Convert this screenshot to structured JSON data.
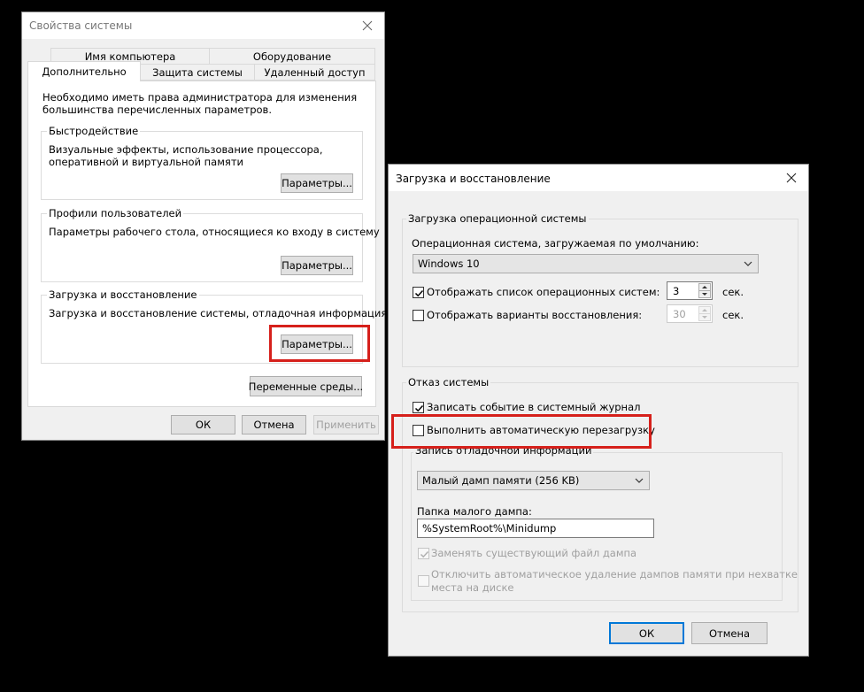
{
  "system_props": {
    "title": "Свойства системы",
    "tabs_row1": [
      "Имя компьютера",
      "Оборудование"
    ],
    "tabs_row2": [
      "Дополнительно",
      "Защита системы",
      "Удаленный доступ"
    ],
    "admin_note": "Необходимо иметь права администратора для изменения большинства перечисленных параметров.",
    "performance": {
      "legend": "Быстродействие",
      "desc": "Визуальные эффекты, использование процессора, оперативной и виртуальной памяти",
      "button": "Параметры..."
    },
    "profiles": {
      "legend": "Профили пользователей",
      "desc": "Параметры рабочего стола, относящиеся ко входу в систему",
      "button": "Параметры..."
    },
    "startup": {
      "legend": "Загрузка и восстановление",
      "desc": "Загрузка и восстановление системы, отладочная информация",
      "button": "Параметры..."
    },
    "env_button": "Переменные среды...",
    "ok": "ОК",
    "cancel": "Отмена",
    "apply": "Применить"
  },
  "startup_recovery": {
    "title": "Загрузка и восстановление",
    "os_group": {
      "legend": "Загрузка операционной системы",
      "default_os_label": "Операционная система, загружаемая по умолчанию:",
      "default_os_value": "Windows 10",
      "show_list_label": "Отображать список операционных систем:",
      "show_list_checked": true,
      "show_list_value": "3",
      "show_recovery_label": "Отображать варианты восстановления:",
      "show_recovery_checked": false,
      "show_recovery_value": "30",
      "sec": "сек."
    },
    "failure_group": {
      "legend": "Отказ системы",
      "write_event_label": "Записать событие в системный журнал",
      "write_event_checked": true,
      "auto_restart_label": "Выполнить автоматическую перезагрузку",
      "auto_restart_checked": false,
      "debug_legend": "Запись отладочной информации",
      "dump_type_value": "Малый дамп памяти (256 KB)",
      "dump_folder_label": "Папка малого дампа:",
      "dump_folder_value": "%SystemRoot%\\Minidump",
      "overwrite_label": "Заменять существующий файл дампа",
      "disable_autodelete_label_1": "Отключить автоматическое удаление дампов памяти при нехватке",
      "disable_autodelete_label_2": "места на диске"
    },
    "ok": "ОК",
    "cancel": "Отмена"
  },
  "colors": {
    "highlight": "#d6201b",
    "accent": "#0078d7"
  }
}
